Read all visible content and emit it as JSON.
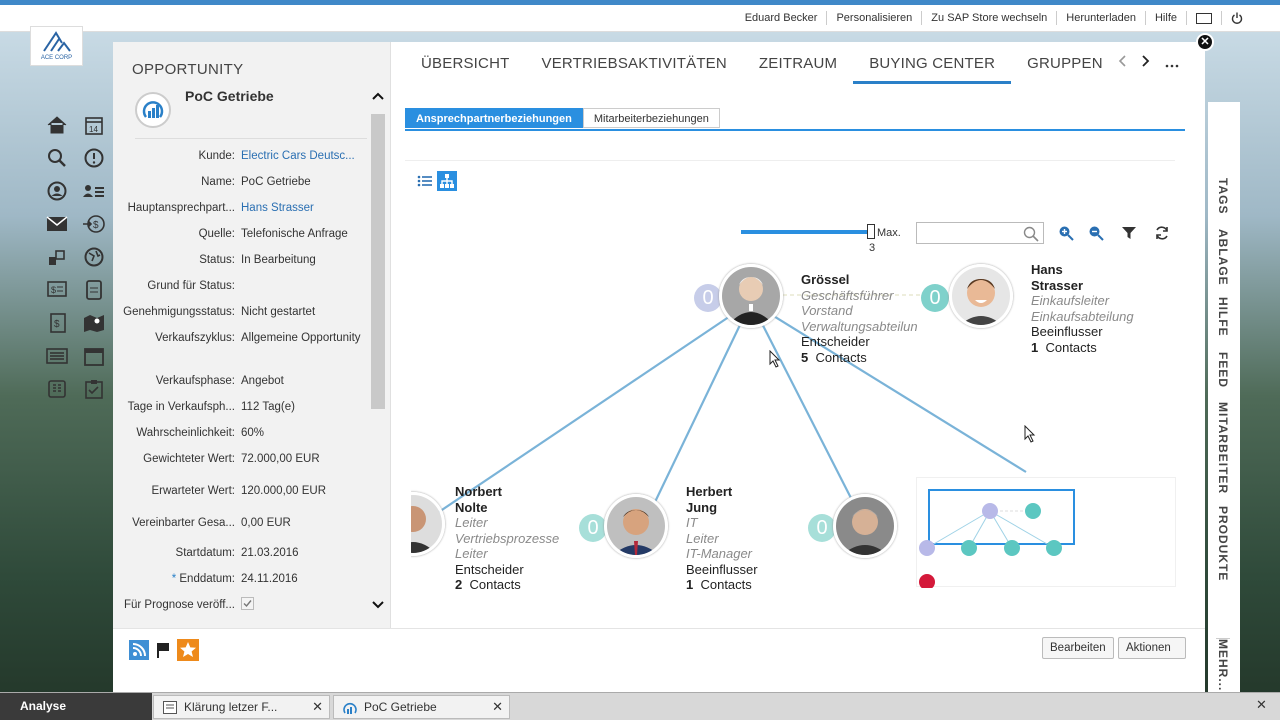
{
  "topbar": {
    "user": "Eduard Becker",
    "links": [
      "Personalisieren",
      "Zu SAP Store wechseln",
      "Herunterladen",
      "Hilfe"
    ]
  },
  "logo": {
    "text": "ACE CORP"
  },
  "panel": {
    "title": "OPPORTUNITY",
    "name": "PoC Getriebe",
    "fields": [
      {
        "label": "Kunde:",
        "value": "Electric Cars Deutsc...",
        "link": true
      },
      {
        "label": "Name:",
        "value": "PoC Getriebe"
      },
      {
        "label": "Hauptansprechpart...",
        "value": "Hans Strasser",
        "link": true
      },
      {
        "label": "Quelle:",
        "value": "Telefonische Anfrage"
      },
      {
        "label": "Status:",
        "value": "In Bearbeitung"
      },
      {
        "label": "Grund für Status:",
        "value": ""
      },
      {
        "label": "Genehmigungsstatus:",
        "value": "Nicht gestartet"
      },
      {
        "label": "Verkaufszyklus:",
        "value": "Allgemeine Opportunity"
      },
      {
        "label": "Verkaufsphase:",
        "value": "Angebot"
      },
      {
        "label": "Tage in Verkaufsph...",
        "value": "112 Tag(e)"
      },
      {
        "label": "Wahrscheinlichkeit:",
        "value": "60%"
      },
      {
        "label": "Gewichteter Wert:",
        "value": "72.000,00 EUR"
      },
      {
        "label": "Erwarteter Wert:",
        "value": "120.000,00 EUR"
      },
      {
        "label": "Vereinbarter Gesa...",
        "value": "0,00 EUR"
      },
      {
        "label": "Startdatum:",
        "value": "21.03.2016"
      },
      {
        "label": "Enddatum:",
        "value": "24.11.2016",
        "required": "*"
      },
      {
        "label": "Für Prognose veröff...",
        "value": ""
      }
    ]
  },
  "tabs": [
    "ÜBERSICHT",
    "VERTRIEBSAKTIVITÄTEN",
    "ZEITRAUM",
    "BUYING CENTER",
    "GRUPPEN"
  ],
  "subtabs": [
    "Ansprechpartnerbeziehungen",
    "Mitarbeiterbeziehungen"
  ],
  "slider": {
    "label": "Max.",
    "value": "3"
  },
  "search": {
    "placeholder": ""
  },
  "nodes": {
    "groessel": {
      "name": "Grössel",
      "roles": [
        "Geschäftsführer",
        "Vorstand",
        "Verwaltungsabteilun"
      ],
      "type": "Entscheider",
      "count": "5",
      "count_label": "Contacts",
      "badge": "0"
    },
    "strasser": {
      "name1": "Hans",
      "name2": "Strasser",
      "roles": [
        "Einkaufsleiter",
        "Einkaufsabteilung"
      ],
      "type": "Beeinflusser",
      "count": "1",
      "count_label": "Contacts",
      "badge": "0"
    },
    "nolte": {
      "name1": "Norbert",
      "name2": "Nolte",
      "roles": [
        "Leiter",
        "Vertriebsprozesse",
        "Leiter"
      ],
      "type": "Entscheider",
      "count": "2",
      "count_label": "Contacts"
    },
    "jung": {
      "name1": "Herbert",
      "name2": "Jung",
      "roles": [
        "IT",
        "Leiter",
        "IT-Manager"
      ],
      "type": "Beeinflusser",
      "count": "1",
      "count_label": "Contacts",
      "badge": "0"
    },
    "fourth": {
      "badge": "0"
    }
  },
  "bottom": {
    "edit": "Bearbeiten",
    "actions": "Aktionen"
  },
  "sidebar": [
    "TAGS",
    "ABLAGE",
    "HILFE",
    "FEED",
    "MITARBEITER",
    "PRODUKTE"
  ],
  "sidebar_more": "MEHR...",
  "taskbar": {
    "start": "Analyse",
    "items": [
      "Klärung letzer F...",
      "PoC Getriebe"
    ]
  }
}
